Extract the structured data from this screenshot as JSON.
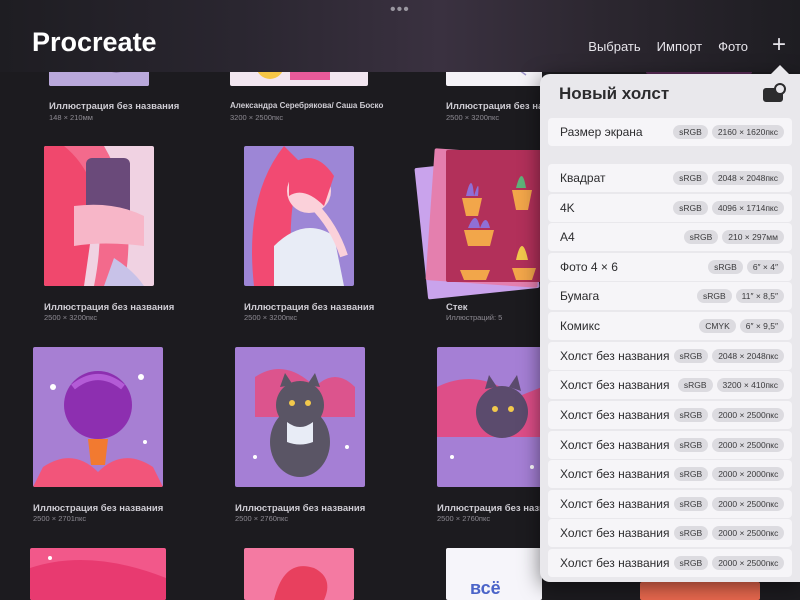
{
  "app": {
    "title": "Procreate"
  },
  "toolbar": {
    "select": "Выбрать",
    "import": "Импорт",
    "photo": "Фото",
    "more": "•••",
    "plus": "+"
  },
  "gallery": [
    {
      "title": "Иллюстрация без названия",
      "size": "148 × 210мм"
    },
    {
      "title": "Александра Серебрякова/ Саша Боско",
      "size": "3200 × 2500пкс"
    },
    {
      "title": "Иллюстрация без названия",
      "size": "2500 × 3200пкс"
    },
    {
      "title": "Иллюстрация без названия",
      "size": "2500 × 3200пкс"
    },
    {
      "title": "Иллюстрация без названия",
      "size": "2500 × 3200пкс"
    },
    {
      "title": "Стек",
      "size": "Иллюстраций: 5"
    },
    {
      "title": "Иллюстрация без названия",
      "size": "2500 × 2701пкс"
    },
    {
      "title": "Иллюстрация без названия",
      "size": "2500 × 2760пкс"
    },
    {
      "title": "Иллюстрация без названия",
      "size": "2500 × 2760пкс"
    }
  ],
  "popover": {
    "title": "Новый холст",
    "screen": {
      "name": "Размер экрана",
      "color": "sRGB",
      "size": "2160 × 1620пкс"
    },
    "presets": [
      {
        "name": "Квадрат",
        "color": "sRGB",
        "size": "2048 × 2048пкс"
      },
      {
        "name": "4K",
        "color": "sRGB",
        "size": "4096 × 1714пкс"
      },
      {
        "name": "A4",
        "color": "sRGB",
        "size": "210 × 297мм"
      },
      {
        "name": "Фото 4 × 6",
        "color": "sRGB",
        "size": "6″ × 4″"
      },
      {
        "name": "Бумага",
        "color": "sRGB",
        "size": "11″ × 8,5″"
      },
      {
        "name": "Комикс",
        "color": "CMYK",
        "size": "6″ × 9,5″"
      },
      {
        "name": "Холст без названия",
        "color": "sRGB",
        "size": "2048 × 2048пкс"
      },
      {
        "name": "Холст без названия",
        "color": "sRGB",
        "size": "3200 × 410пкс"
      },
      {
        "name": "Холст без названия",
        "color": "sRGB",
        "size": "2000 × 2500пкс"
      },
      {
        "name": "Холст без названия",
        "color": "sRGB",
        "size": "2000 × 2500пкс"
      },
      {
        "name": "Холст без названия",
        "color": "sRGB",
        "size": "2000 × 2000пкс"
      },
      {
        "name": "Холст без названия",
        "color": "sRGB",
        "size": "2000 × 2500пкс"
      },
      {
        "name": "Холст без названия",
        "color": "sRGB",
        "size": "2000 × 2500пкс"
      },
      {
        "name": "Холст без названия",
        "color": "sRGB",
        "size": "2000 × 2500пкс"
      }
    ]
  }
}
